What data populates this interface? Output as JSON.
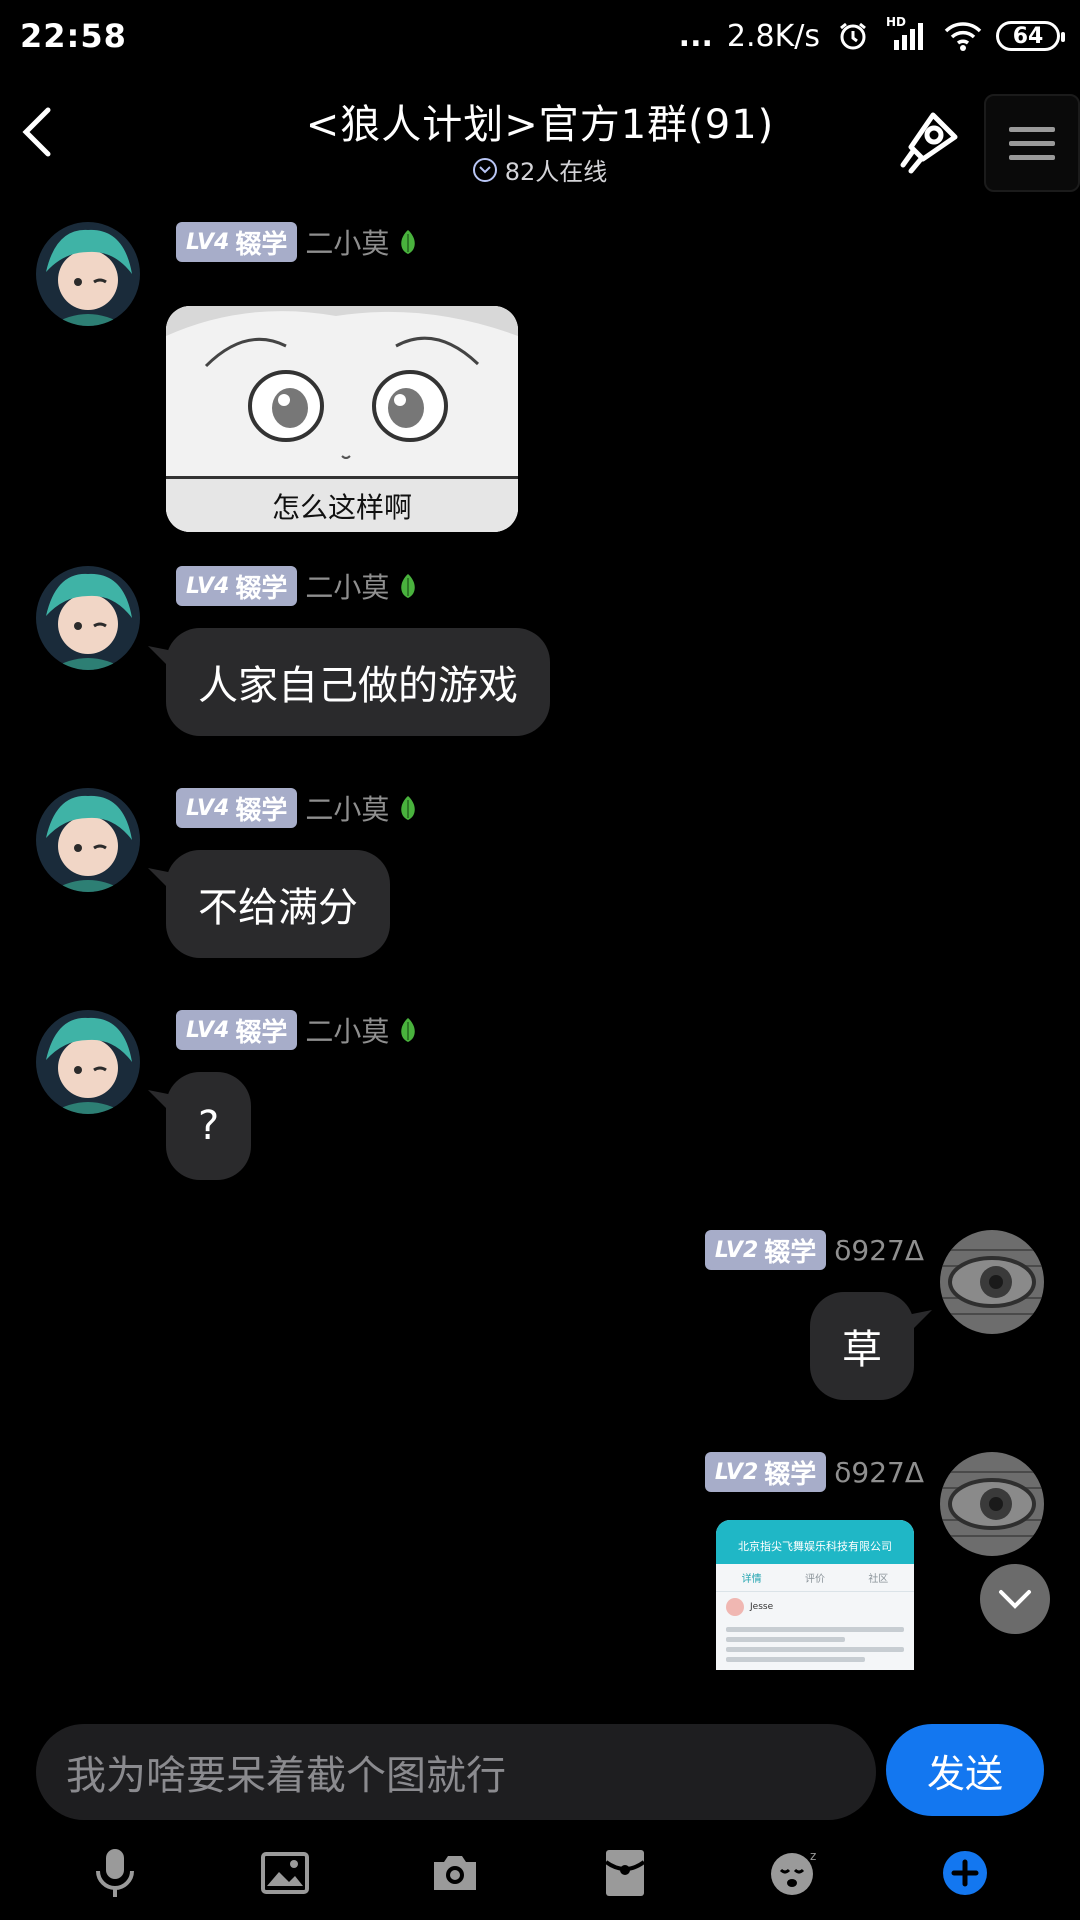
{
  "status_bar": {
    "time": "22:58",
    "dots": "...",
    "net_speed": "2.8K/s",
    "hd_label": "HD",
    "battery": "64"
  },
  "header": {
    "title": "<狼人计划>官方1群(91)",
    "online": "82人在线"
  },
  "messages": [
    {
      "sender": "二小莫",
      "level": "LV4",
      "badge": "辍学",
      "image_caption": "怎么这样啊"
    },
    {
      "sender": "二小莫",
      "level": "LV4",
      "badge": "辍学",
      "text": "人家自己做的游戏"
    },
    {
      "sender": "二小莫",
      "level": "LV4",
      "badge": "辍学",
      "text": "不给满分"
    },
    {
      "sender": "二小莫",
      "level": "LV4",
      "badge": "辍学",
      "text": "?"
    },
    {
      "sender": "δ927Δ",
      "level": "LV2",
      "badge": "辍学",
      "text": "草"
    },
    {
      "sender": "δ927Δ",
      "level": "LV2",
      "badge": "辍学",
      "screenshot": {
        "title": "北京指尖飞舞娱乐科技有限公司",
        "tabs": [
          "详情",
          "评价",
          "社区"
        ],
        "user": "Jesse"
      }
    }
  ],
  "composer": {
    "value": "我为啥要呆着截个图就行",
    "send_label": "发送"
  },
  "toolbar": [
    "microphone-icon",
    "image-icon",
    "camera-icon",
    "red-packet-icon",
    "emoji-icon",
    "plus-icon"
  ],
  "colors": {
    "background": "#000000",
    "bubble": "#2a2a2c",
    "level_badge": "#a7adc9",
    "send_button": "#1377f0",
    "plus_button": "#1377f0"
  }
}
